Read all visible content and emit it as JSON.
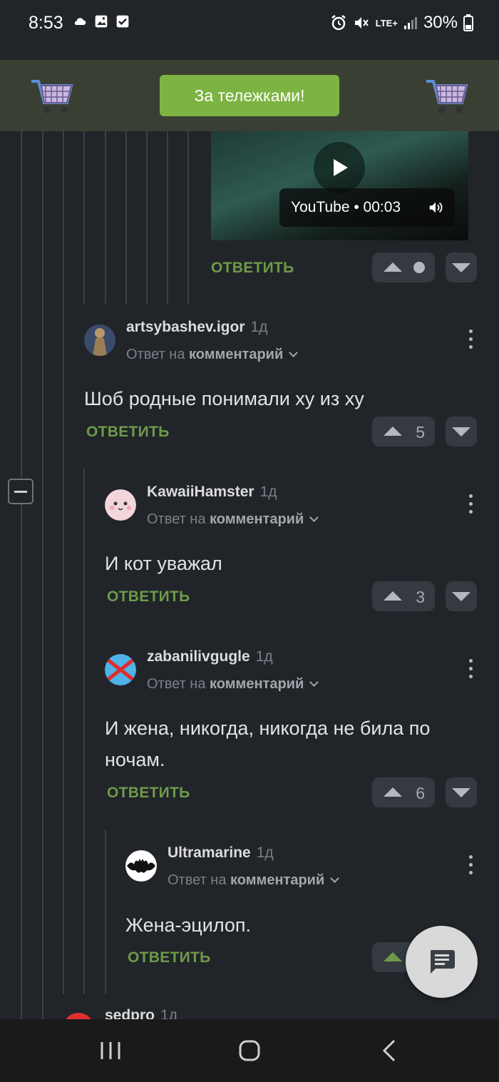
{
  "status_bar": {
    "time": "8:53",
    "network": "LTE+",
    "battery": "30%"
  },
  "promo": {
    "button_label": "За тележками!"
  },
  "video": {
    "label": "YouTube • 00:03"
  },
  "top_comment": {
    "reply_label": "ОТВЕТИТЬ"
  },
  "comments": [
    {
      "username": "artsybashev.igor",
      "time": "1д",
      "reply_to_prefix": "Ответ на",
      "reply_to_link": "комментарий",
      "text": "Шоб родные понимали ху из ху",
      "reply_label": "ОТВЕТИТЬ",
      "rating": "5"
    },
    {
      "username": "KawaiiHamster",
      "time": "1д",
      "reply_to_prefix": "Ответ на",
      "reply_to_link": "комментарий",
      "text": "И кот уважал",
      "reply_label": "ОТВЕТИТЬ",
      "rating": "3"
    },
    {
      "username": "zabanilivgugle",
      "time": "1д",
      "reply_to_prefix": "Ответ на",
      "reply_to_link": "комментарий",
      "text": "И жена, никогда, никогда не била по ночам.",
      "reply_label": "ОТВЕТИТЬ",
      "rating": "6"
    },
    {
      "username": "Ultramarine",
      "time": "1д",
      "reply_to_prefix": "Ответ на",
      "reply_to_link": "комментарий",
      "text": "Жена-эцилоп.",
      "reply_label": "ОТВЕТИТЬ"
    },
    {
      "username": "sedpro",
      "time": "1д"
    }
  ],
  "colors": {
    "background": "#212529",
    "accent_green": "#7cb342",
    "reply_green": "#6e9a49",
    "promo_bg": "#3a3f33"
  },
  "icons": {
    "cart": "shopping-cart-icon",
    "play": "play-icon",
    "speaker": "volume-icon",
    "fab": "comment-icon",
    "nav": [
      "recents-icon",
      "home-icon",
      "back-icon"
    ]
  }
}
